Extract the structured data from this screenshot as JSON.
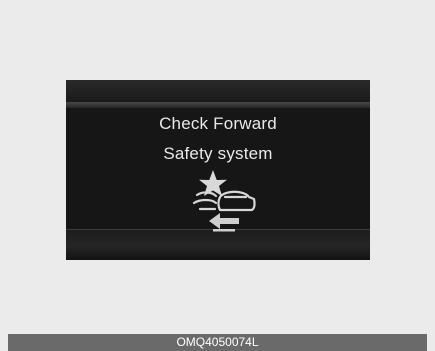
{
  "display": {
    "message_line_1": "Check Forward",
    "message_line_2": "Safety system"
  },
  "caption": {
    "code": "OMQ4050074L"
  },
  "colors": {
    "page_background": "#ebebeb",
    "panel_background": "#161616",
    "message_text": "#e9e9e9",
    "caption_bar": "#6a6a6a"
  },
  "icons": [
    "forward-collision-warning-icon"
  ]
}
